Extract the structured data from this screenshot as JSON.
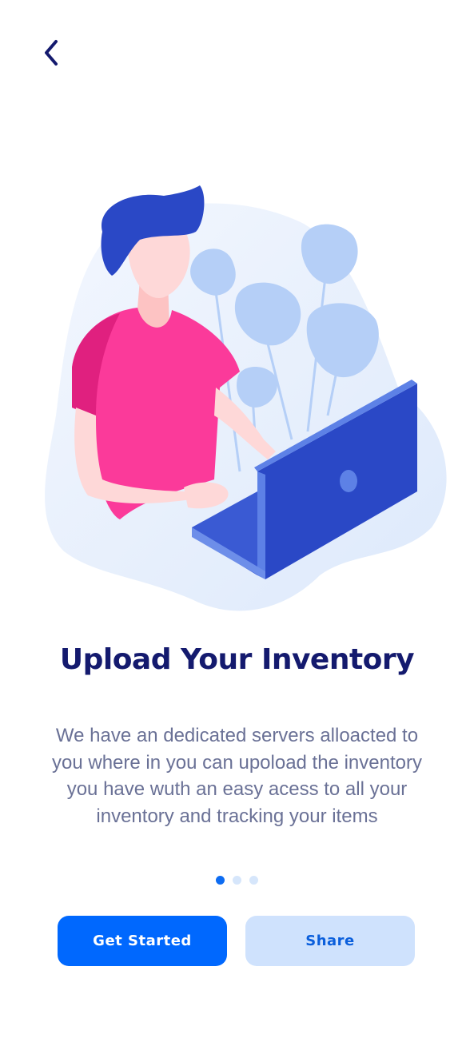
{
  "header": {
    "back_icon": "chevron-left-icon"
  },
  "onboarding": {
    "title": "Upload Your Inventory",
    "description": "We have an dedicated servers alloacted to you where in you can upoload the inventory you have wuth an easy acess to all your inventory and tracking your items",
    "page_indicator": {
      "total": 3,
      "active_index": 0
    }
  },
  "actions": {
    "primary_label": "Get Started",
    "secondary_label": "Share"
  },
  "colors": {
    "primary": "#0068fe",
    "secondary_bg": "#cfe2fd",
    "title": "#141a6e",
    "body_text": "#6a7196"
  }
}
